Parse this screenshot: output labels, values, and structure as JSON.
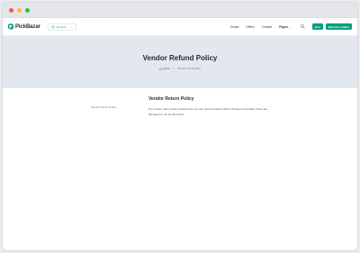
{
  "colors": {
    "brand": "#009f7f",
    "hero_bg": "#e3e8ee"
  },
  "header": {
    "logo": "PickBazar",
    "shop_selector": "Grocery",
    "nav": [
      "Shops",
      "Offers",
      "Contact",
      "Pages"
    ],
    "join_button": "Join",
    "seller_button": "Become a Seller"
  },
  "hero": {
    "title": "Vendor Refund Policy",
    "breadcrumb": {
      "home": "Home",
      "current": "Vendor refund policy"
    }
  },
  "sidebar": {
    "link": "Vendor Return Policy"
  },
  "main": {
    "title": "Vendor Return Policy",
    "text": "Our vendor return policy ensures that you can return products within 15 days of purchase if they are damaged or not as described."
  }
}
